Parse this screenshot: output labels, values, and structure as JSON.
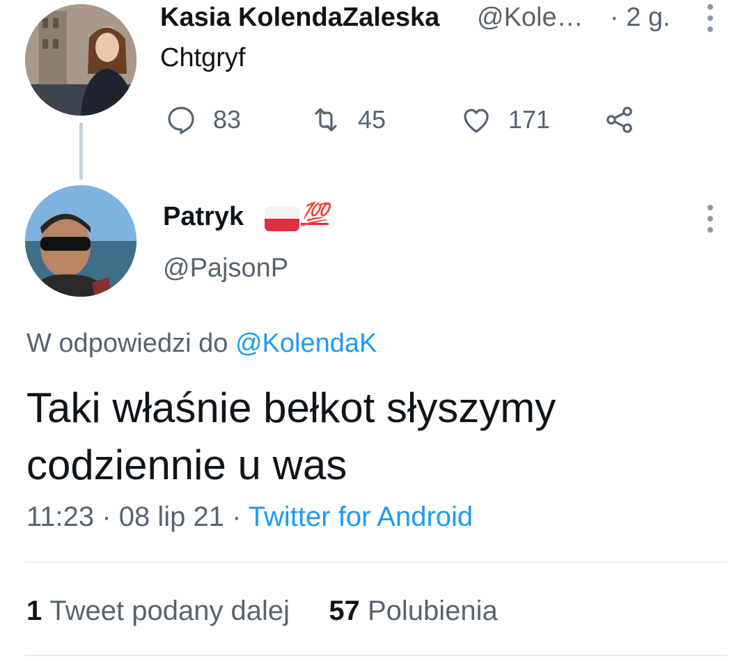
{
  "parent_tweet": {
    "author_name": "Kasia KolendaZaleska",
    "author_handle": "@Kole…",
    "time": "· 2 g.",
    "text": "Chtgryf",
    "actions": {
      "replies": "83",
      "retweets": "45",
      "likes": "171"
    }
  },
  "reply_tweet": {
    "author_name": "Patryk",
    "name_emoji": "💯",
    "author_handle": "@PajsonP",
    "reply_prefix": "W odpowiedzi do",
    "reply_to_handle": "@KolendaK",
    "text": "Taki właśnie bełkot słyszymy codziennie u was",
    "time": "11:23",
    "date": "08 lip 21",
    "separator": "·",
    "client": "Twitter for Android",
    "stats": {
      "retweets_count": "1",
      "retweets_label": "Tweet podany dalej",
      "likes_count": "57",
      "likes_label": "Polubienia"
    }
  },
  "colors": {
    "link": "#1d9bf0",
    "muted": "#566370",
    "text": "#0f1419"
  }
}
